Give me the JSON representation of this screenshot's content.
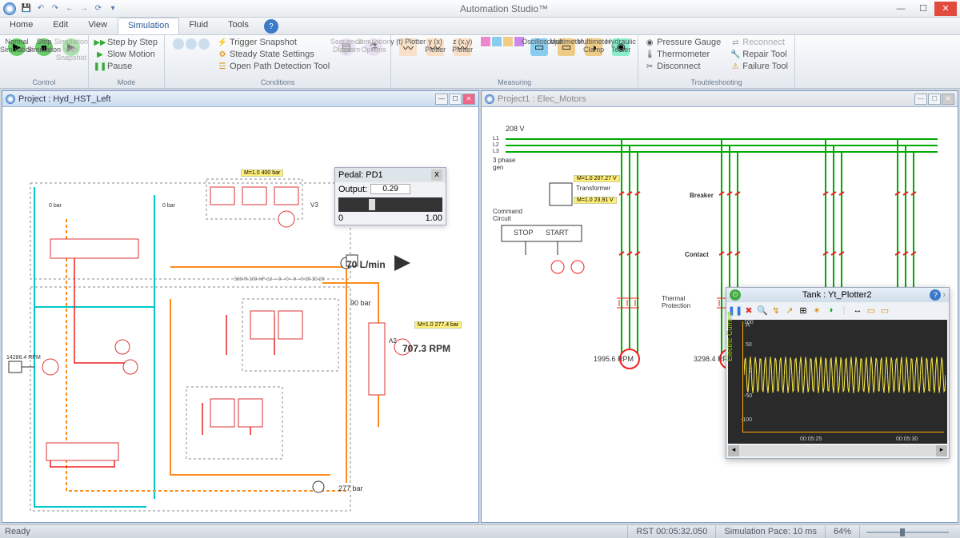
{
  "app": {
    "title": "Automation Studio™"
  },
  "tabs": [
    "Home",
    "Edit",
    "View",
    "Simulation",
    "Fluid",
    "Tools"
  ],
  "activeTab": "Simulation",
  "ribbon": {
    "control": {
      "label": "Control",
      "normal": "Normal\nSimulation",
      "stop": "Stop\nSimulation",
      "snapshot": "Simulation\nwith Snapshot"
    },
    "mode": {
      "label": "Mode",
      "step": "Step by Step",
      "slow": "Slow Motion",
      "pause": "Pause"
    },
    "conditions": {
      "label": "Conditions",
      "trigger": "Trigger Snapshot",
      "steady": "Steady State Settings",
      "open": "Open Path Detection Tool",
      "seq": "Sequence\nDiagram",
      "opts": "Simulation\nOptions"
    },
    "measuring": {
      "label": "Measuring",
      "y": "y (t)\nPlotter",
      "yx": "y (x)\nPlotter",
      "z": "z (x,y)\nPlotter",
      "osc": "Oscilloscope",
      "mm": "Multimeter",
      "mmc": "Multimeter\nClamp",
      "hyd": "Hydraulic\nTester"
    },
    "trouble": {
      "label": "Troubleshooting",
      "pg": "Pressure Gauge",
      "rc": "Reconnect",
      "th": "Thermometer",
      "rt": "Repair Tool",
      "dc": "Disconnect",
      "ft": "Failure Tool"
    }
  },
  "doc1": {
    "title": "Project : Hyd_HST_Left"
  },
  "doc2": {
    "title": "Project1 : Elec_Motors"
  },
  "hydraulic": {
    "flowLabel": "70 L/min",
    "pressure1": "90 bar",
    "pressure2": "277 bar",
    "rpm": "707.3 RPM",
    "tag1": "M=1.0    400 bar",
    "tag2": "M=1.0    277.4 bar",
    "gauge1": "0 bar",
    "gauge2": "0 bar",
    "idlabel": "14286.4 RPM",
    "portA2": "A2",
    "portV3": "V3",
    "noteLine": "580-R-100-HF-12----0---0---0---0-30-30-20"
  },
  "pedal": {
    "title": "Pedal: PD1",
    "outputLabel": "Output:",
    "value": "0.29",
    "min": "0",
    "max": "1.00"
  },
  "elec": {
    "voltage": "208 V",
    "phases": "3 phase\ngen",
    "l1": "L1",
    "l2": "L2",
    "l3": "L3",
    "transformer": "Transformer",
    "breaker": "Breaker",
    "cmd": "Command\nCircuit",
    "stop": "STOP",
    "start": "START",
    "contact": "Contact",
    "thermal": "Thermal\nProtection",
    "rpm1": "1995.6 RPM",
    "rpm2": "3298.4 RPM",
    "tagV1": "M=1.0    207.27 V",
    "tagV2": "M=1.0    23.91 V"
  },
  "plotter": {
    "title": "Tank : Yt_Plotter2",
    "ylabel": "Electric Current",
    "unit": "A",
    "ticks": [
      "100",
      "50",
      "0",
      "-50",
      "-100"
    ],
    "xticks": [
      "00:05:25",
      "00:05:30"
    ]
  },
  "status": {
    "ready": "Ready",
    "rst": "RST 00:05:32.050",
    "pace": "Simulation Pace: 10 ms",
    "zoom": "64%"
  },
  "chart_data": {
    "type": "line",
    "title": "Tank : Yt_Plotter2",
    "ylabel": "Electric Current",
    "yunit": "A",
    "ylim": [
      -100,
      100
    ],
    "xlim": [
      "00:05:22",
      "00:05:32"
    ],
    "xticks": [
      "00:05:25",
      "00:05:30"
    ],
    "series": [
      {
        "name": "Current",
        "color": "#ffee44",
        "waveform": "sine",
        "amplitude": 35,
        "offset": 0,
        "frequency_hz": 4,
        "samples": 400
      }
    ]
  }
}
